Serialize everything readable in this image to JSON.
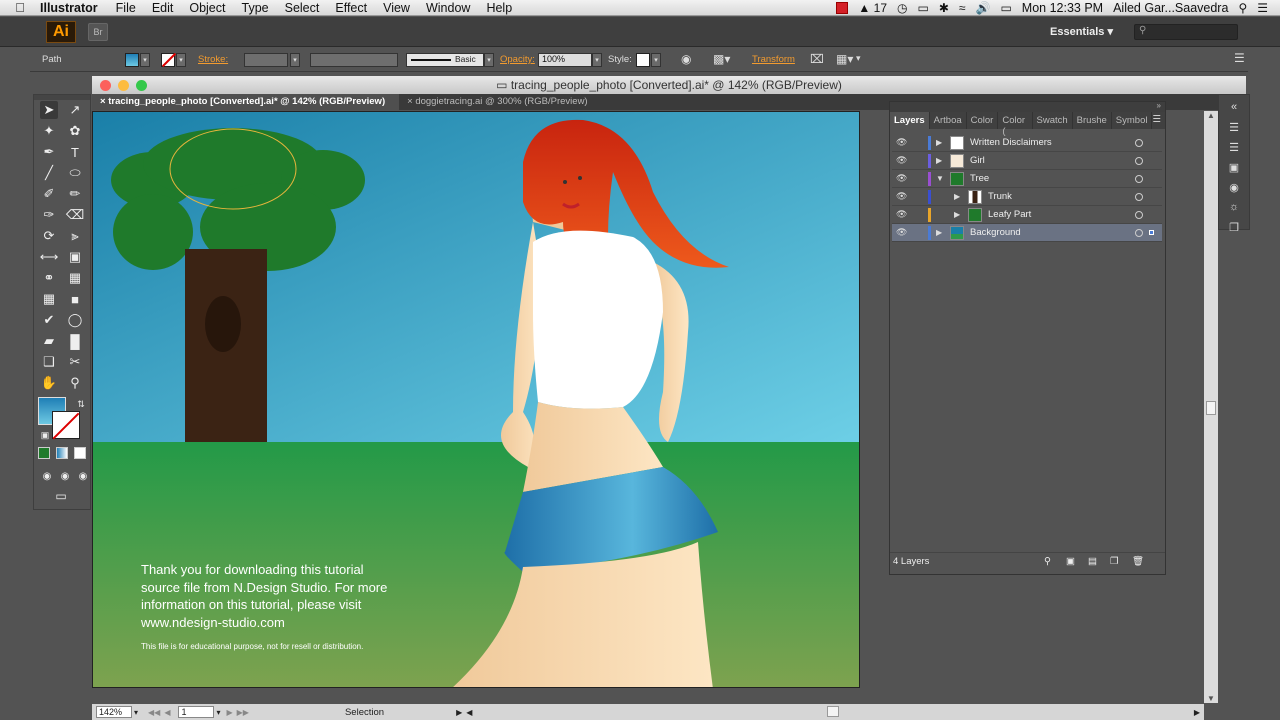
{
  "menubar": {
    "app_name": "Illustrator",
    "items": [
      "File",
      "Edit",
      "Object",
      "Type",
      "Select",
      "Effect",
      "View",
      "Window",
      "Help"
    ],
    "adobe_badge": "17",
    "clock": "Mon 12:33 PM",
    "user": "Ailed Gar...Saavedra"
  },
  "appbar": {
    "logo": "Ai",
    "bridge": "Br",
    "workspace": "Essentials",
    "search_placeholder": ""
  },
  "controlbar": {
    "selection_type": "Path",
    "stroke_label": "Stroke:",
    "brush_label": "Basic",
    "opacity_label": "Opacity:",
    "opacity_value": "100%",
    "style_label": "Style:",
    "transform_label": "Transform"
  },
  "document": {
    "window_title": "tracing_people_photo [Converted].ai* @ 142% (RGB/Preview)",
    "tabs": [
      {
        "label": "tracing_people_photo [Converted].ai* @ 142% (RGB/Preview)",
        "active": true
      },
      {
        "label": "doggietracing.ai @ 300% (RGB/Preview)",
        "active": false
      }
    ],
    "art_text_lines": [
      "Thank you for downloading this tutorial",
      "source file from N.Design Studio. For more",
      "information on this tutorial, please visit",
      "www.ndesign-studio.com"
    ],
    "art_note": "This file is for educational purpose, not for resell or distribution."
  },
  "layers_panel": {
    "tabs": [
      "Layers",
      "Artboa",
      "Color",
      "Color (",
      "Swatch",
      "Brushe",
      "Symbol"
    ],
    "rows": [
      {
        "name": "Written Disclaimers",
        "indent": 0,
        "expanded": false,
        "color": "#4a7bd6",
        "selected": false
      },
      {
        "name": "Girl",
        "indent": 0,
        "expanded": false,
        "color": "#6b5ee0",
        "selected": false
      },
      {
        "name": "Tree",
        "indent": 0,
        "expanded": true,
        "color": "#9a4fd1",
        "selected": false
      },
      {
        "name": "Trunk",
        "indent": 1,
        "expanded": false,
        "color": "#3a4fd1",
        "selected": false
      },
      {
        "name": "Leafy Part",
        "indent": 1,
        "expanded": false,
        "color": "#e8a52a",
        "selected": false
      },
      {
        "name": "Background",
        "indent": 0,
        "expanded": false,
        "color": "#4a7bd6",
        "selected": true
      }
    ],
    "footer": "4 Layers"
  },
  "statusbar": {
    "zoom": "142%",
    "page": "1",
    "tool_status": "Selection"
  },
  "colors": {
    "sky_top": "#1a7fa8",
    "sky_bottom": "#6dcfe6",
    "grass": "#2e9a4b",
    "tree_green": "#1f7a2b",
    "trunk": "#3b2314",
    "hair": "#e8431a",
    "skirt": "#2a8fc4",
    "accent_orange": "#f29b2f"
  }
}
